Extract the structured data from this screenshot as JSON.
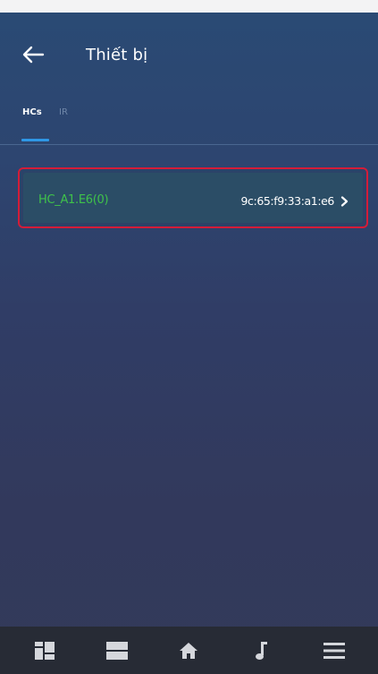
{
  "header": {
    "title": "Thiết bị",
    "back_icon": "arrow-left-icon"
  },
  "tabs": [
    {
      "label": "HCs",
      "active": true
    },
    {
      "label": "IR",
      "active": false
    }
  ],
  "devices": [
    {
      "name": "HC_A1.E6(0)",
      "mac": "9c:65:f9:33:a1:e6",
      "selected": true
    }
  ],
  "bottom_nav": {
    "items": [
      {
        "icon": "dashboard-icon"
      },
      {
        "icon": "rooms-list-icon"
      },
      {
        "icon": "home-icon"
      },
      {
        "icon": "music-note-icon"
      },
      {
        "icon": "menu-icon"
      }
    ]
  },
  "colors": {
    "accent": "#2f98e6",
    "device_name": "#3fc24a",
    "selection_border": "#d41c38",
    "nav_background": "#272b35"
  }
}
